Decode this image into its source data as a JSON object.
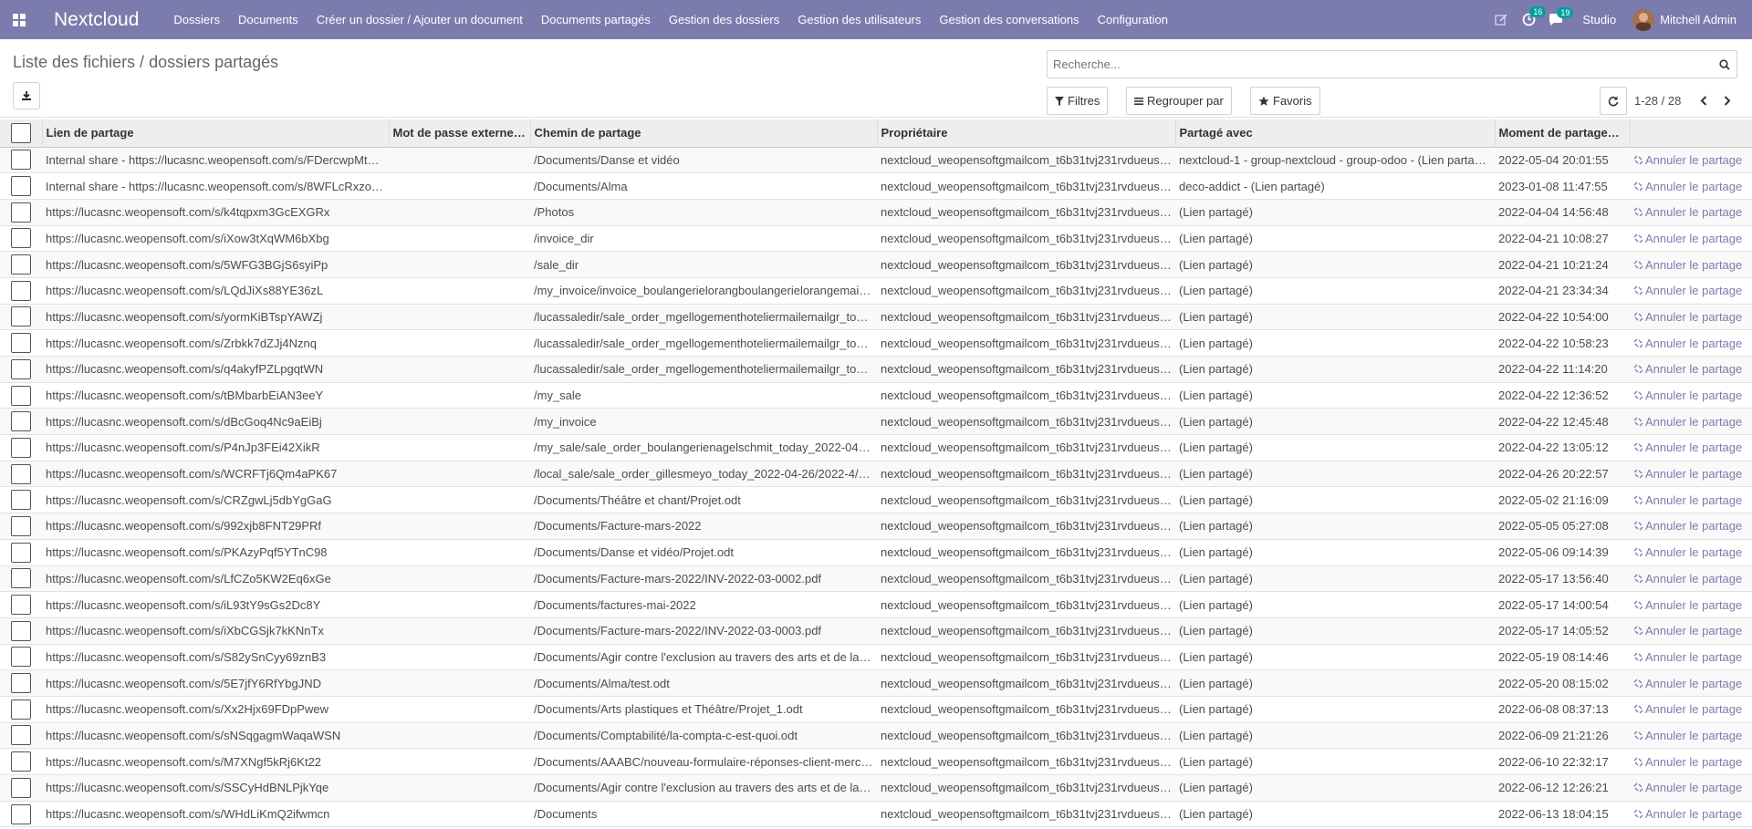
{
  "navbar": {
    "brand": "Nextcloud",
    "menu": [
      "Dossiers",
      "Documents",
      "Créer un dossier / Ajouter un document",
      "Documents partagés",
      "Gestion des dossiers",
      "Gestion des utilisateurs",
      "Gestion des conversations",
      "Configuration"
    ],
    "activity_count": "16",
    "messages_count": "19",
    "studio": "Studio",
    "user_name": "Mitchell Admin"
  },
  "control_panel": {
    "breadcrumb": "Liste des fichiers / dossiers partagés",
    "search_placeholder": "Recherche...",
    "filters": "Filtres",
    "group_by": "Regrouper par",
    "favorites": "Favoris",
    "pager": "1-28 / 28"
  },
  "table": {
    "columns": [
      "Lien de partage",
      "Mot de passe externe…",
      "Chemin de partage",
      "Propriétaire",
      "Partagé avec",
      "Moment de partage…"
    ],
    "cancel_label": "Annuler le partage",
    "rows": [
      {
        "link": "Internal share - https://lucasnc.weopensoft.com/s/FDercwpMt…",
        "password": "",
        "path": "/Documents/Danse et vidéo",
        "owner": "nextcloud_weopensoftgmailcom_t6b31tvj231rvdueus…",
        "shared_with": "nextcloud-1 - group-nextcloud - group-odoo - (Lien partagé)",
        "date": "2022-05-04 20:01:55"
      },
      {
        "link": "Internal share - https://lucasnc.weopensoft.com/s/8WFLcRxzo…",
        "password": "",
        "path": "/Documents/Alma",
        "owner": "nextcloud_weopensoftgmailcom_t6b31tvj231rvdueus…",
        "shared_with": "deco-addict - (Lien partagé)",
        "date": "2023-01-08 11:47:55"
      },
      {
        "link": "https://lucasnc.weopensoft.com/s/k4tqpxm3GcEXGRx",
        "password": "",
        "path": "/Photos",
        "owner": "nextcloud_weopensoftgmailcom_t6b31tvj231rvdueus…",
        "shared_with": "(Lien partagé)",
        "date": "2022-04-04 14:56:48"
      },
      {
        "link": "https://lucasnc.weopensoft.com/s/iXow3tXqWM6bXbg",
        "password": "",
        "path": "/invoice_dir",
        "owner": "nextcloud_weopensoftgmailcom_t6b31tvj231rvdueus…",
        "shared_with": "(Lien partagé)",
        "date": "2022-04-21 10:08:27"
      },
      {
        "link": "https://lucasnc.weopensoft.com/s/5WFG3BGjS6syiPp",
        "password": "",
        "path": "/sale_dir",
        "owner": "nextcloud_weopensoftgmailcom_t6b31tvj231rvdueus…",
        "shared_with": "(Lien partagé)",
        "date": "2022-04-21 10:21:24"
      },
      {
        "link": "https://lucasnc.weopensoft.com/s/LQdJiXs88YE36zL",
        "password": "",
        "path": "/my_invoice/invoice_boulangerielorangboulangerielorangemail…",
        "owner": "nextcloud_weopensoftgmailcom_t6b31tvj231rvdueus…",
        "shared_with": "(Lien partagé)",
        "date": "2022-04-21 23:34:34"
      },
      {
        "link": "https://lucasnc.weopensoft.com/s/yormKiBTspYAWZj",
        "password": "",
        "path": "/lucassaledir/sale_order_mgellogementhoteliermailemailgr_to…",
        "owner": "nextcloud_weopensoftgmailcom_t6b31tvj231rvdueus…",
        "shared_with": "(Lien partagé)",
        "date": "2022-04-22 10:54:00"
      },
      {
        "link": "https://lucasnc.weopensoft.com/s/Zrbkk7dZJj4Nznq",
        "password": "",
        "path": "/lucassaledir/sale_order_mgellogementhoteliermailemailgr_to…",
        "owner": "nextcloud_weopensoftgmailcom_t6b31tvj231rvdueus…",
        "shared_with": "(Lien partagé)",
        "date": "2022-04-22 10:58:23"
      },
      {
        "link": "https://lucasnc.weopensoft.com/s/q4akyfPZLpgqtWN",
        "password": "",
        "path": "/lucassaledir/sale_order_mgellogementhoteliermailemailgr_to…",
        "owner": "nextcloud_weopensoftgmailcom_t6b31tvj231rvdueus…",
        "shared_with": "(Lien partagé)",
        "date": "2022-04-22 11:14:20"
      },
      {
        "link": "https://lucasnc.weopensoft.com/s/tBMbarbEiAN3eeY",
        "password": "",
        "path": "/my_sale",
        "owner": "nextcloud_weopensoftgmailcom_t6b31tvj231rvdueus…",
        "shared_with": "(Lien partagé)",
        "date": "2022-04-22 12:36:52"
      },
      {
        "link": "https://lucasnc.weopensoft.com/s/dBcGoq4Nc9aEiBj",
        "password": "",
        "path": "/my_invoice",
        "owner": "nextcloud_weopensoftgmailcom_t6b31tvj231rvdueus…",
        "shared_with": "(Lien partagé)",
        "date": "2022-04-22 12:45:48"
      },
      {
        "link": "https://lucasnc.weopensoft.com/s/P4nJp3FEi42XikR",
        "password": "",
        "path": "/my_sale/sale_order_boulangerienagelschmit_today_2022-04…",
        "owner": "nextcloud_weopensoftgmailcom_t6b31tvj231rvdueus…",
        "shared_with": "(Lien partagé)",
        "date": "2022-04-22 13:05:12"
      },
      {
        "link": "https://lucasnc.weopensoft.com/s/WCRFTj6Qm4aPK67",
        "password": "",
        "path": "/local_sale/sale_order_gillesmeyo_today_2022-04-26/2022-4/…",
        "owner": "nextcloud_weopensoftgmailcom_t6b31tvj231rvdueus…",
        "shared_with": "(Lien partagé)",
        "date": "2022-04-26 20:22:57"
      },
      {
        "link": "https://lucasnc.weopensoft.com/s/CRZgwLj5dbYgGaG",
        "password": "",
        "path": "/Documents/Théâtre et chant/Projet.odt",
        "owner": "nextcloud_weopensoftgmailcom_t6b31tvj231rvdueus…",
        "shared_with": "(Lien partagé)",
        "date": "2022-05-02 21:16:09"
      },
      {
        "link": "https://lucasnc.weopensoft.com/s/992xjb8FNT29PRf",
        "password": "",
        "path": "/Documents/Facture-mars-2022",
        "owner": "nextcloud_weopensoftgmailcom_t6b31tvj231rvdueus…",
        "shared_with": "(Lien partagé)",
        "date": "2022-05-05 05:27:08"
      },
      {
        "link": "https://lucasnc.weopensoft.com/s/PKAzyPqf5YTnC98",
        "password": "",
        "path": "/Documents/Danse et vidéo/Projet.odt",
        "owner": "nextcloud_weopensoftgmailcom_t6b31tvj231rvdueus…",
        "shared_with": "(Lien partagé)",
        "date": "2022-05-06 09:14:39"
      },
      {
        "link": "https://lucasnc.weopensoft.com/s/LfCZo5KW2Eq6xGe",
        "password": "",
        "path": "/Documents/Facture-mars-2022/INV-2022-03-0002.pdf",
        "owner": "nextcloud_weopensoftgmailcom_t6b31tvj231rvdueus…",
        "shared_with": "(Lien partagé)",
        "date": "2022-05-17 13:56:40"
      },
      {
        "link": "https://lucasnc.weopensoft.com/s/iL93tY9sGs2Dc8Y",
        "password": "",
        "path": "/Documents/factures-mai-2022",
        "owner": "nextcloud_weopensoftgmailcom_t6b31tvj231rvdueus…",
        "shared_with": "(Lien partagé)",
        "date": "2022-05-17 14:00:54"
      },
      {
        "link": "https://lucasnc.weopensoft.com/s/iXbCGSjk7kKNnTx",
        "password": "",
        "path": "/Documents/Facture-mars-2022/INV-2022-03-0003.pdf",
        "owner": "nextcloud_weopensoftgmailcom_t6b31tvj231rvdueus…",
        "shared_with": "(Lien partagé)",
        "date": "2022-05-17 14:05:52"
      },
      {
        "link": "https://lucasnc.weopensoft.com/s/S82ySnCyy69znB3",
        "password": "",
        "path": "/Documents/Agir contre l'exclusion au travers des arts et de la…",
        "owner": "nextcloud_weopensoftgmailcom_t6b31tvj231rvdueus…",
        "shared_with": "(Lien partagé)",
        "date": "2022-05-19 08:14:46"
      },
      {
        "link": "https://lucasnc.weopensoft.com/s/5E7jfY6RfYbgJND",
        "password": "",
        "path": "/Documents/Alma/test.odt",
        "owner": "nextcloud_weopensoftgmailcom_t6b31tvj231rvdueus…",
        "shared_with": "(Lien partagé)",
        "date": "2022-05-20 08:15:02"
      },
      {
        "link": "https://lucasnc.weopensoft.com/s/Xx2Hjx69FDpPwew",
        "password": "",
        "path": "/Documents/Arts plastiques et Théâtre/Projet_1.odt",
        "owner": "nextcloud_weopensoftgmailcom_t6b31tvj231rvdueus…",
        "shared_with": "(Lien partagé)",
        "date": "2022-06-08 08:37:13"
      },
      {
        "link": "https://lucasnc.weopensoft.com/s/sNSqgagmWaqaWSN",
        "password": "",
        "path": "/Documents/Comptabilité/la-compta-c-est-quoi.odt",
        "owner": "nextcloud_weopensoftgmailcom_t6b31tvj231rvdueus…",
        "shared_with": "(Lien partagé)",
        "date": "2022-06-09 21:21:26"
      },
      {
        "link": "https://lucasnc.weopensoft.com/s/M7XNgf5kRj6Kt22",
        "password": "",
        "path": "/Documents/AAABC/nouveau-formulaire-réponses-client-merc…",
        "owner": "nextcloud_weopensoftgmailcom_t6b31tvj231rvdueus…",
        "shared_with": "(Lien partagé)",
        "date": "2022-06-10 22:32:17"
      },
      {
        "link": "https://lucasnc.weopensoft.com/s/SSCyHdBNLPjkYqe",
        "password": "",
        "path": "/Documents/Agir contre l'exclusion au travers des arts et de la…",
        "owner": "nextcloud_weopensoftgmailcom_t6b31tvj231rvdueus…",
        "shared_with": "(Lien partagé)",
        "date": "2022-06-12 12:26:21"
      },
      {
        "link": "https://lucasnc.weopensoft.com/s/WHdLiKmQ2ifwmcn",
        "password": "",
        "path": "/Documents",
        "owner": "nextcloud_weopensoftgmailcom_t6b31tvj231rvdueus…",
        "shared_with": "(Lien partagé)",
        "date": "2022-06-13 18:04:15"
      }
    ]
  },
  "colors": {
    "navbar": "#7c7bad",
    "accent": "#00a09d",
    "link": "#7c7bad"
  }
}
